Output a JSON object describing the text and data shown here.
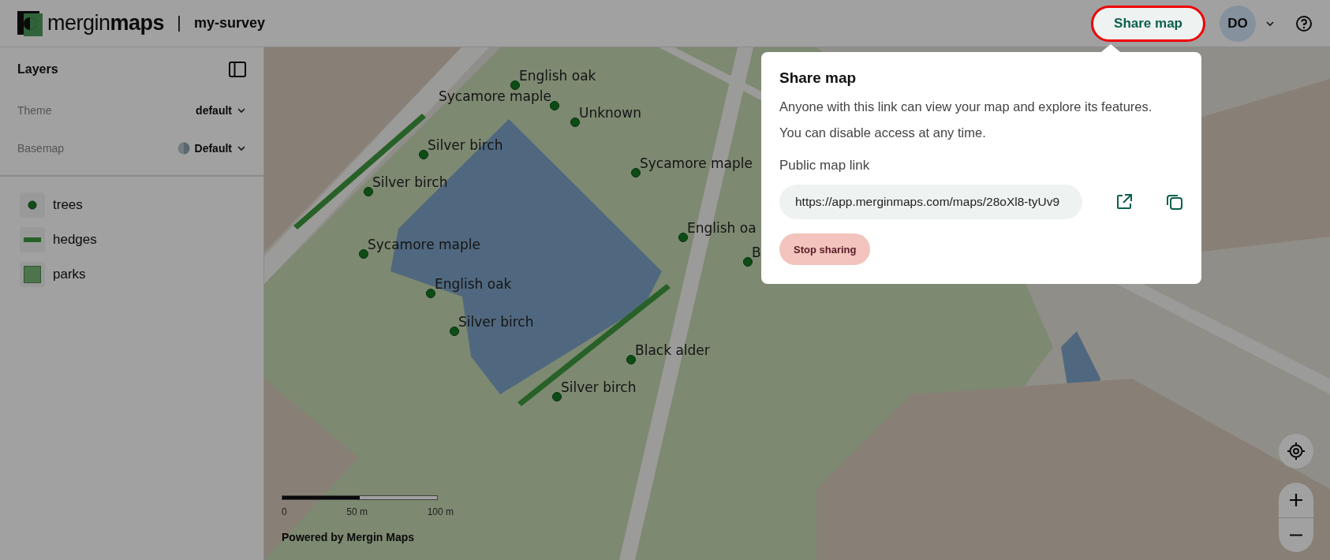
{
  "header": {
    "logo": "mergin**maps**",
    "project": "my-survey",
    "share_button": "Share map",
    "avatar": "DO"
  },
  "sidebar": {
    "title": "Layers",
    "settings": [
      {
        "label": "Theme",
        "value": "default"
      },
      {
        "label": "Basemap",
        "value": "Default"
      }
    ],
    "layers": [
      {
        "name": "trees",
        "kind": "point"
      },
      {
        "name": "hedges",
        "kind": "line"
      },
      {
        "name": "parks",
        "kind": "polygon"
      }
    ]
  },
  "map": {
    "features": [
      {
        "label": "English oak"
      },
      {
        "label": "Sycamore maple"
      },
      {
        "label": "Unknown"
      },
      {
        "label": "Silver birch"
      },
      {
        "label": "Silver birch"
      },
      {
        "label": "Sycamore maple"
      },
      {
        "label": "English oa"
      },
      {
        "label": "B"
      },
      {
        "label": "Sycamore maple"
      },
      {
        "label": "English oak"
      },
      {
        "label": "Silver birch"
      },
      {
        "label": "Black alder"
      },
      {
        "label": "Silver birch"
      }
    ],
    "scale_labels": [
      "0",
      "50 m",
      "100 m"
    ],
    "attribution": "Powered by Mergin Maps"
  },
  "share_popup": {
    "title": "Share map",
    "description": [
      "Anyone with this link can view your map and explore its features.",
      "You can disable access at any time."
    ],
    "link_label": "Public map link",
    "link": "https://app.merginmaps.com/maps/28oXl8-tyUv9",
    "stop_button": "Stop sharing"
  }
}
